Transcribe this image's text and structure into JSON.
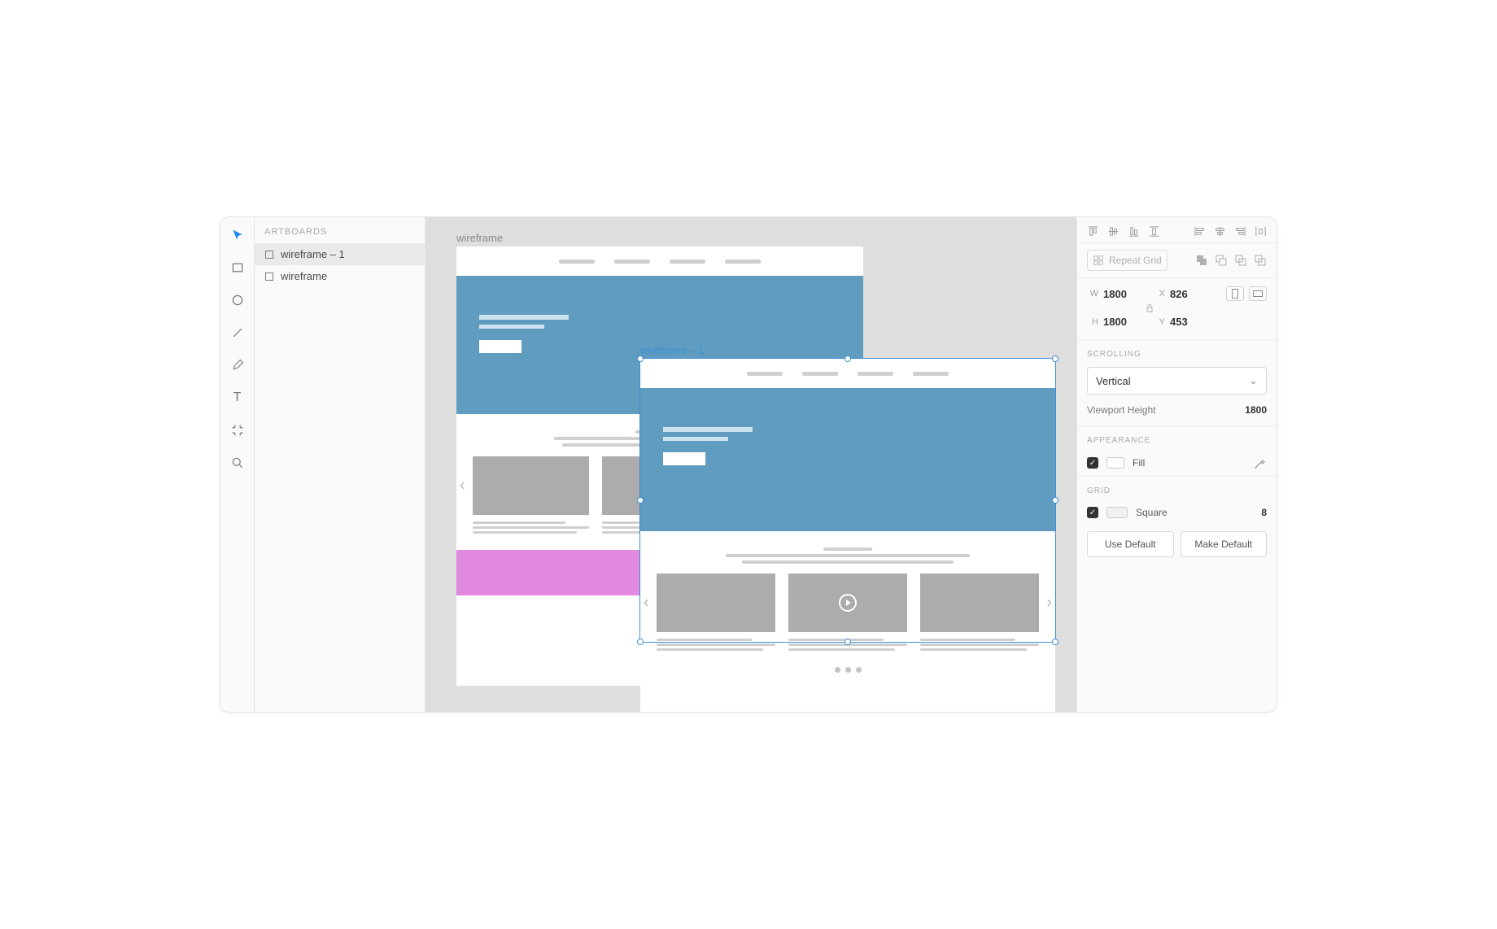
{
  "layers": {
    "header": "ARTBOARDS",
    "items": [
      {
        "label": "wireframe – 1",
        "selected": true
      },
      {
        "label": "wireframe",
        "selected": false
      }
    ]
  },
  "canvas": {
    "artboard_back_label": "wireframe",
    "artboard_front_label": "wireframe – 1"
  },
  "inspector": {
    "repeat_grid_label": "Repeat Grid",
    "dims": {
      "w_label": "W",
      "w_value": "1800",
      "h_label": "H",
      "h_value": "1800",
      "x_label": "X",
      "x_value": "826",
      "y_label": "Y",
      "y_value": "453"
    },
    "scrolling": {
      "header": "SCROLLING",
      "mode": "Vertical",
      "viewport_label": "Viewport Height",
      "viewport_value": "1800"
    },
    "appearance": {
      "header": "APPEARANCE",
      "fill_label": "Fill"
    },
    "grid": {
      "header": "GRID",
      "type_label": "Square",
      "value": "8",
      "use_default": "Use Default",
      "make_default": "Make Default"
    }
  }
}
